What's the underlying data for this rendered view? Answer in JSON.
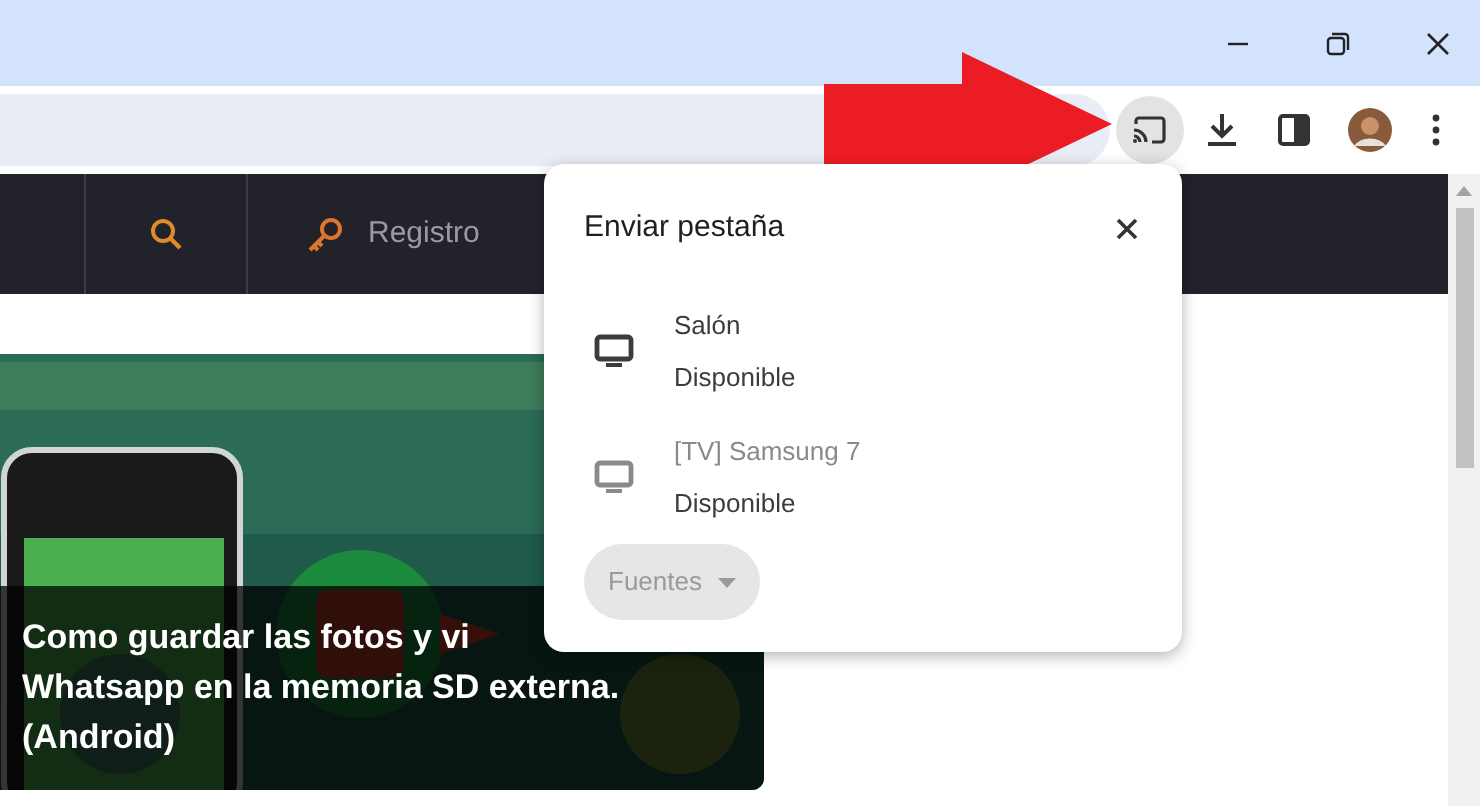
{
  "toolbar": {
    "cast_button": {
      "selected": true
    }
  },
  "nav": {
    "items": [
      {
        "kind": "search"
      },
      {
        "kind": "link",
        "label": "Registro"
      }
    ]
  },
  "article": {
    "caption_lines": [
      "Como guardar las fotos y vi",
      "Whatsapp en la memoria SD externa.",
      "(Android)"
    ]
  },
  "cast_dialog": {
    "title": "Enviar pestaña",
    "devices": [
      {
        "name": "Salón",
        "status": "Disponible",
        "disabled": false
      },
      {
        "name": "[TV] Samsung 7",
        "status": "Disponible",
        "disabled": true
      }
    ],
    "sources_button": {
      "label": "Fuentes",
      "disabled": true
    }
  }
}
